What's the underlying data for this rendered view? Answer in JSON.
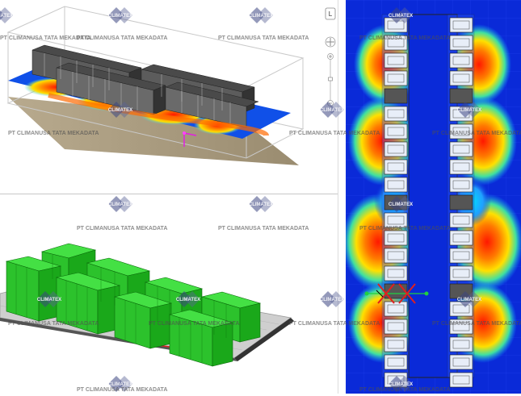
{
  "watermark": {
    "logo_text": "CLIMATEX",
    "company": "PT CLIMANUSA TATA MEKADATA"
  },
  "navigator": {
    "orientation_label": "L"
  },
  "colors": {
    "rack": "#3c3c3c",
    "hot": "#ff2000",
    "warm": "#ffd000",
    "cool": "#00d0ff",
    "cold": "#0a2ad8",
    "floor": "#a89a80",
    "rack_green": "#22cc22"
  }
}
